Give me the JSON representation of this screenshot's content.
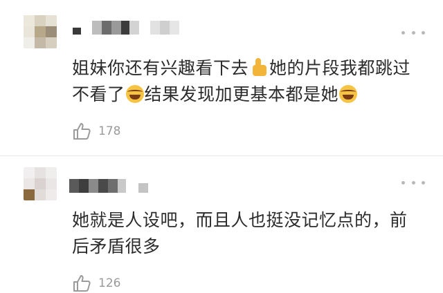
{
  "comments": [
    {
      "text_line1": "姐妹你还有兴趣看下去",
      "text_line1b": "她的片段我都跳过",
      "text_line2a": "不看了",
      "text_line2b": "结果发现加更基本都是她",
      "likes": "178",
      "emoji": [
        "thumbs-up-icon",
        "laughing-face-icon",
        "laughing-face-icon"
      ]
    },
    {
      "text_line1": "她就是人设吧，而且人也挺没记忆点的，前",
      "text_line2": "后矛盾很多",
      "likes": "126"
    }
  ],
  "colors": {
    "text": "#2b2b2b",
    "meta": "#9a9a9a",
    "divider": "#e6e6e6",
    "emoji": "#f6c445"
  }
}
